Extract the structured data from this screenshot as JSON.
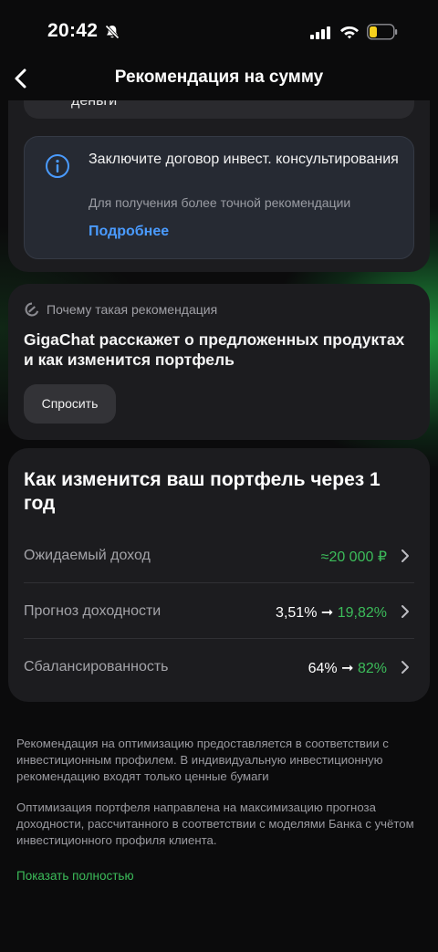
{
  "status_bar": {
    "time": "20:42",
    "icons": [
      "bell-off-icon",
      "signal-icon",
      "wifi-icon",
      "battery-icon"
    ]
  },
  "nav": {
    "title": "Рекомендация на сумму",
    "back_icon": "chevron-left-icon"
  },
  "previous_block": {
    "text": "деньги"
  },
  "info_card": {
    "title": "Заключите договор инвест. консультирования",
    "subtitle": "Для получения более точной рекомендации",
    "link": "Подробнее",
    "icon": "info-icon"
  },
  "giga_card": {
    "caption": "Почему такая рекомендация",
    "title": "GigaChat расскажет о предложенных продуктах и как изменится портфель",
    "button": "Спросить",
    "icon": "gigachat-icon"
  },
  "portfolio": {
    "title": "Как изменится ваш портфель через 1 год",
    "rows": [
      {
        "label": "Ожидаемый доход",
        "from": "",
        "to": "≈20 000 ₽"
      },
      {
        "label": "Прогноз доходности",
        "from": "3,51%",
        "to": "19,82%"
      },
      {
        "label": "Сбалансированность",
        "from": "64%",
        "to": "82%"
      }
    ]
  },
  "disclaimer": {
    "p1": "Рекомендация на оптимизацию предоставляется в соответствии с инвестиционным профилем. В индивидуальную инвестиционную рекомендацию входят только ценные бумаги",
    "p2": "Оптимизация портфеля направлена на максимизацию прогноза доходности, рассчитанного в соответствии с моделями Банка с учётом инвестиционного профиля клиента.",
    "show_full": "Показать полностью"
  },
  "colors": {
    "accent_green": "#3cbc5a",
    "link_blue": "#4a9bff",
    "card_bg": "#1c1c1f"
  }
}
